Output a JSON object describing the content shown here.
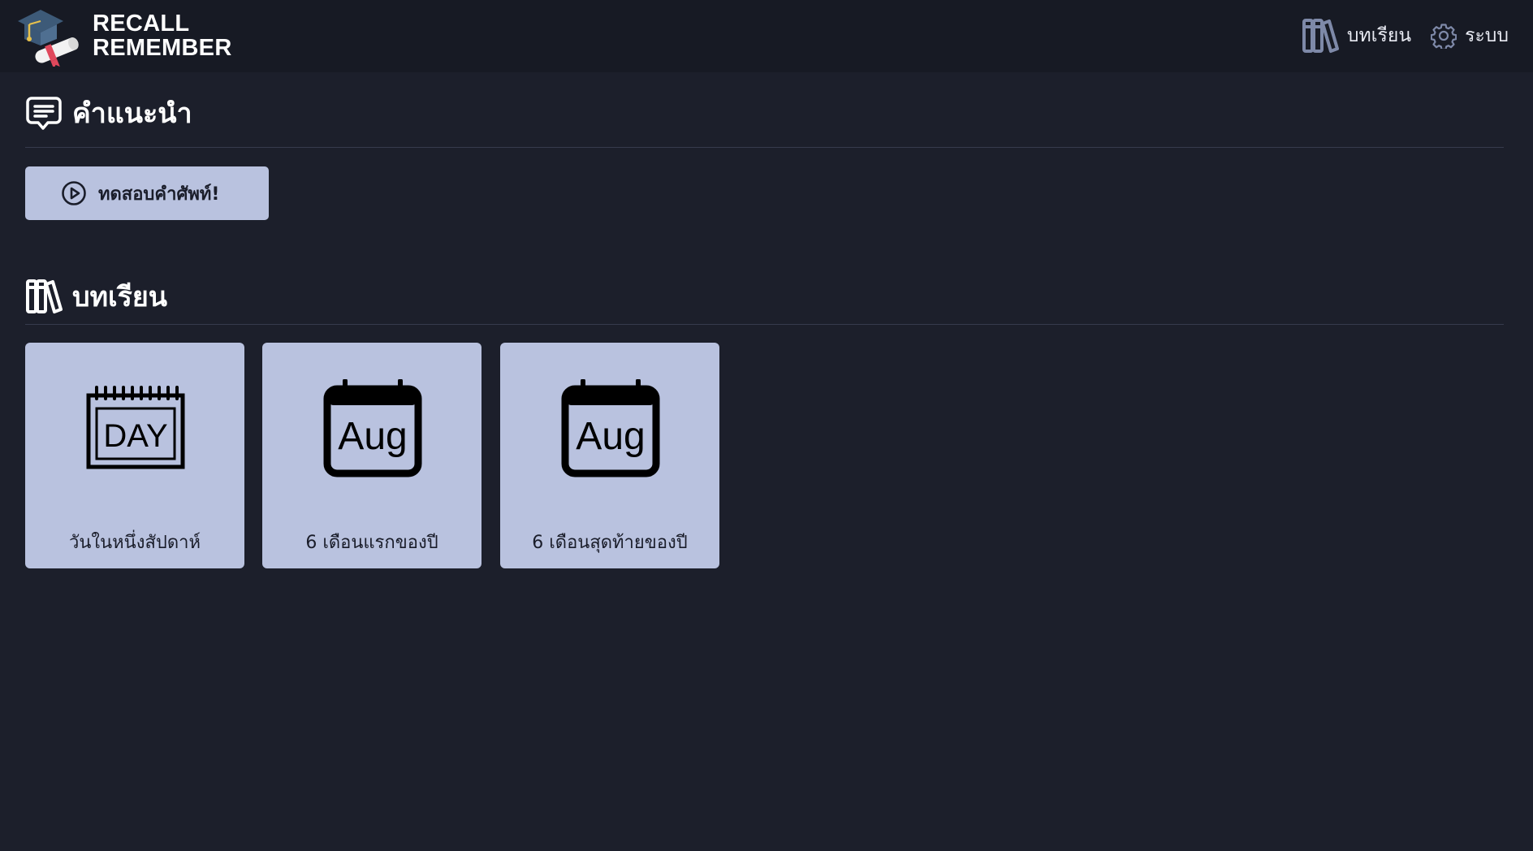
{
  "brand": {
    "line1": "RECALL",
    "line2": "REMEMBER",
    "logo_icon": "graduation-cap-diploma-icon"
  },
  "nav": {
    "lessons_label": "บทเรียน",
    "lessons_icon": "books-icon",
    "system_label": "ระบบ",
    "system_icon": "gear-icon"
  },
  "guide": {
    "title": "คำแนะนำ",
    "icon": "chat-bubble-icon",
    "quiz_button_label": "ทดสอบคำศัพท์!",
    "quiz_button_icon": "play-circle-icon"
  },
  "lessons": {
    "title": "บทเรียน",
    "icon": "books-icon",
    "cards": [
      {
        "label": "วันในหนึ่งสัปดาห์",
        "icon": "day-calendar-icon",
        "icon_text": "DAY"
      },
      {
        "label": "6 เดือนแรกของปี",
        "icon": "month-calendar-icon",
        "icon_text": "Aug"
      },
      {
        "label": "6 เดือนสุดท้ายของปี",
        "icon": "month-calendar-icon",
        "icon_text": "Aug"
      }
    ]
  },
  "colors": {
    "background": "#1c1f2b",
    "topbar": "#171a24",
    "card": "#b9c2df",
    "card_text": "#1a1d2a",
    "divider": "#363b4d"
  }
}
